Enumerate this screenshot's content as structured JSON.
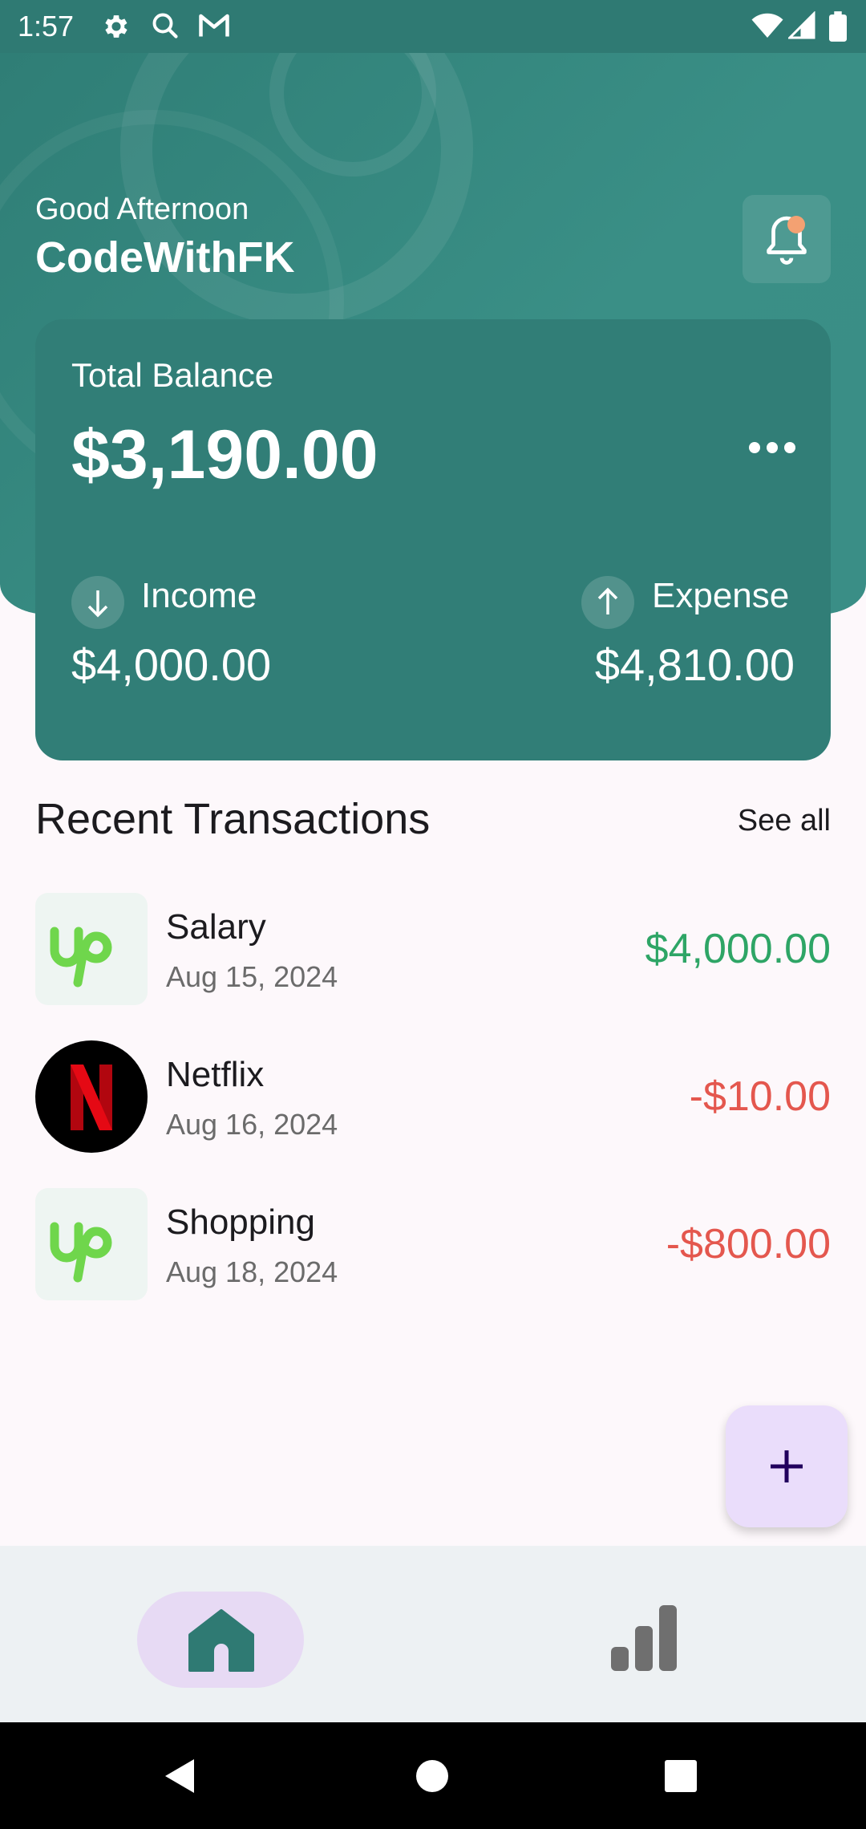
{
  "status_bar": {
    "time": "1:57",
    "icons": [
      "settings-icon",
      "search-icon",
      "gmail-icon",
      "wifi-icon",
      "signal-icon",
      "battery-icon"
    ]
  },
  "header": {
    "greeting": "Good Afternoon",
    "username": "CodeWithFK",
    "notification_icon": "bell-icon"
  },
  "balance_card": {
    "label": "Total Balance",
    "amount": "$3,190.00",
    "more_icon": "more-horizontal-icon",
    "income": {
      "label": "Income",
      "amount": "$4,000.00",
      "icon": "arrow-down-icon"
    },
    "expense": {
      "label": "Expense",
      "amount": "$4,810.00",
      "icon": "arrow-up-icon"
    }
  },
  "transactions": {
    "title": "Recent Transactions",
    "see_all": "See all",
    "items": [
      {
        "name": "Salary",
        "date": "Aug 15, 2024",
        "amount": "$4,000.00",
        "logo": "upwork-logo"
      },
      {
        "name": "Netflix",
        "date": "Aug 16, 2024",
        "amount": "-$10.00",
        "logo": "netflix-logo"
      },
      {
        "name": "Shopping",
        "date": "Aug 18, 2024",
        "amount": "-$800.00",
        "logo": "upwork-logo"
      }
    ]
  },
  "fab": {
    "icon": "plus-icon"
  },
  "bottom_nav": {
    "items": [
      {
        "icon": "home-icon",
        "selected": true
      },
      {
        "icon": "bar-chart-icon",
        "selected": false
      }
    ]
  },
  "system_nav": {
    "icons": [
      "back-icon",
      "home-circle-icon",
      "recents-icon"
    ]
  },
  "colors": {
    "primary": "#317E77",
    "income": "#2EA566",
    "expense": "#E4574E",
    "fab": "#EADDFB",
    "notification_dot": "#F4A172"
  }
}
